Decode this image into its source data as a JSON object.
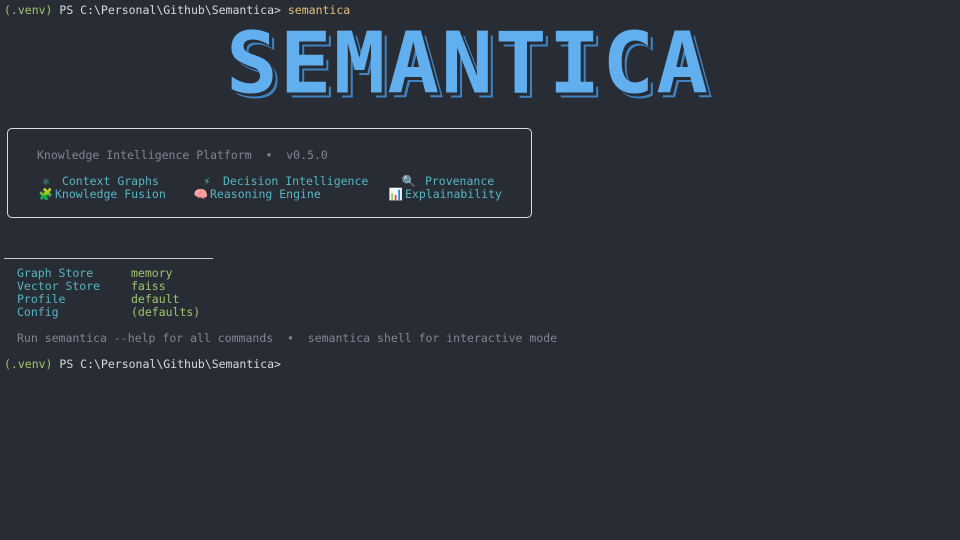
{
  "terminal": {
    "prompt_venv": "(.venv)",
    "prompt_path": " PS C:\\Personal\\Github\\Semantica> ",
    "command": "semantica",
    "prompt2_venv": "(.venv)",
    "prompt2_path": " PS C:\\Personal\\Github\\Semantica>"
  },
  "banner": {
    "logo_text": "SEMANTICA"
  },
  "infobox": {
    "subtitle": "Knowledge Intelligence Platform  •  v0.5.0",
    "features": [
      {
        "icon": "⚛",
        "label": "Context Graphs"
      },
      {
        "icon": "⚡",
        "label": "Decision Intelligence"
      },
      {
        "icon": "🔍",
        "label": "Provenance"
      },
      {
        "icon": "🧩",
        "label": "Knowledge Fusion"
      },
      {
        "icon": "🧠",
        "label": "Reasoning Engine"
      },
      {
        "icon": "📊",
        "label": "Explainability"
      }
    ]
  },
  "config": [
    {
      "key": "Graph Store",
      "value": "memory"
    },
    {
      "key": "Vector Store",
      "value": "faiss"
    },
    {
      "key": "Profile",
      "value": "default"
    },
    {
      "key": "Config",
      "value": "(defaults)"
    }
  ],
  "hint": "Run semantica --help for all commands  •  semantica shell for interactive mode",
  "colors": {
    "background": "#282c34",
    "accent": "#61afef",
    "key": "#56b6c2",
    "value": "#9ec76e"
  }
}
